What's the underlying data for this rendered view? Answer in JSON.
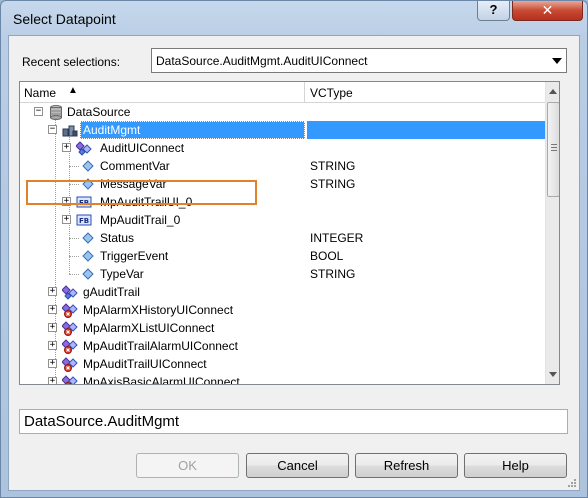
{
  "window": {
    "title": "Select Datapoint",
    "help_button": "?",
    "close_button": "✕"
  },
  "recent": {
    "label": "Recent selections:",
    "value": "DataSource.AuditMgmt.AuditUIConnect"
  },
  "tree": {
    "columns": {
      "name": "Name",
      "vctype": "VCType",
      "sort_indicator": "▲"
    },
    "rows": [
      {
        "label": "DataSource",
        "vctype": ""
      },
      {
        "label": "AuditMgmt",
        "vctype": ""
      },
      {
        "label": "AuditUIConnect",
        "vctype": ""
      },
      {
        "label": "CommentVar",
        "vctype": "STRING"
      },
      {
        "label": "MessageVar",
        "vctype": "STRING"
      },
      {
        "label": "MpAuditTrailUI_0",
        "vctype": ""
      },
      {
        "label": "MpAuditTrail_0",
        "vctype": ""
      },
      {
        "label": "Status",
        "vctype": "INTEGER"
      },
      {
        "label": "TriggerEvent",
        "vctype": "BOOL"
      },
      {
        "label": "TypeVar",
        "vctype": "STRING"
      },
      {
        "label": "gAuditTrail",
        "vctype": ""
      },
      {
        "label": "MpAlarmXHistoryUIConnect",
        "vctype": ""
      },
      {
        "label": "MpAlarmXListUIConnect",
        "vctype": ""
      },
      {
        "label": "MpAuditTrailAlarmUIConnect",
        "vctype": ""
      },
      {
        "label": "MpAuditTrailUIConnect",
        "vctype": ""
      },
      {
        "label": "MpAxisBasicAlarmUIConnect",
        "vctype": ""
      }
    ]
  },
  "path": {
    "value": "DataSource.AuditMgmt"
  },
  "buttons": {
    "ok": "OK",
    "cancel": "Cancel",
    "refresh": "Refresh",
    "help": "Help"
  },
  "colors": {
    "selection": "#3399ff",
    "highlight_box": "#e0822a"
  }
}
